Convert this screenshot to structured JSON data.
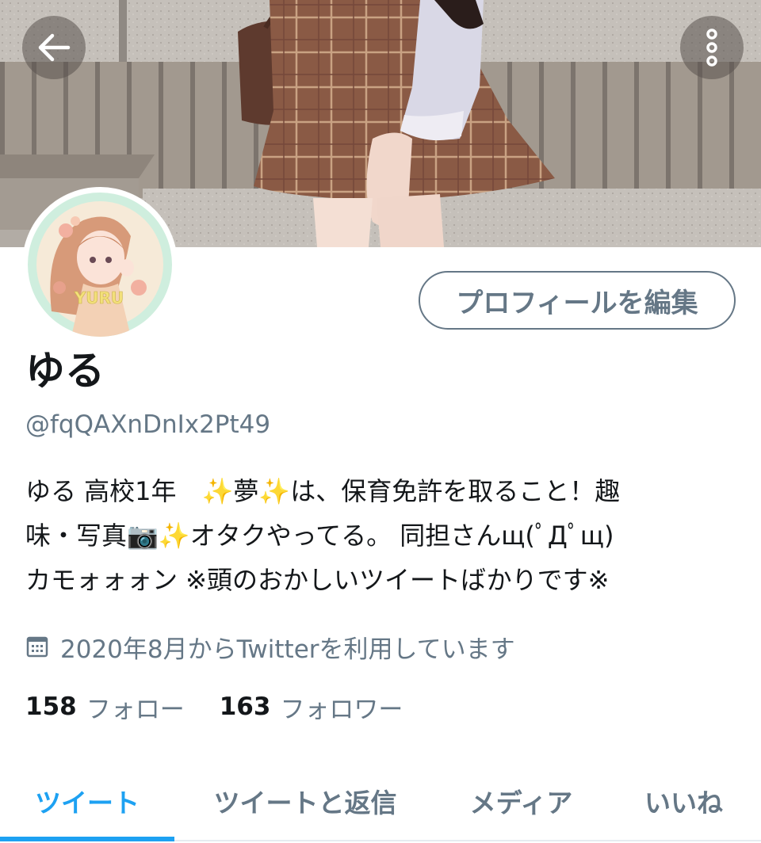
{
  "header": {
    "back_icon": "arrow-left-icon",
    "more_icon": "more-vertical-icon"
  },
  "profile": {
    "display_name": "ゆる",
    "handle": "@fqQAXnDnIx2Pt49",
    "avatar_text": "YURU",
    "edit_button_label": "プロフィールを編集",
    "bio_lines": [
      "ゆる 高校1年　✨夢✨は、保育免許を取ること！趣",
      "味・写真📷✨オタクやってる。 同担さんщ(ﾟДﾟщ)",
      "カモォォォン ※頭のおかしいツイートばかりです※"
    ],
    "joined_icon": "calendar-icon",
    "joined_text": "2020年8月からTwitterを利用しています",
    "following_count": "158",
    "following_label": "フォロー",
    "followers_count": "163",
    "followers_label": "フォロワー"
  },
  "tabs": [
    {
      "label": "ツイート",
      "active": true
    },
    {
      "label": "ツイートと返信",
      "active": false
    },
    {
      "label": "メディア",
      "active": false
    },
    {
      "label": "いいね",
      "active": false
    }
  ],
  "colors": {
    "accent": "#1da1f2",
    "secondary_text": "#657786",
    "primary_text": "#14171a",
    "divider": "#e6ecf0"
  }
}
